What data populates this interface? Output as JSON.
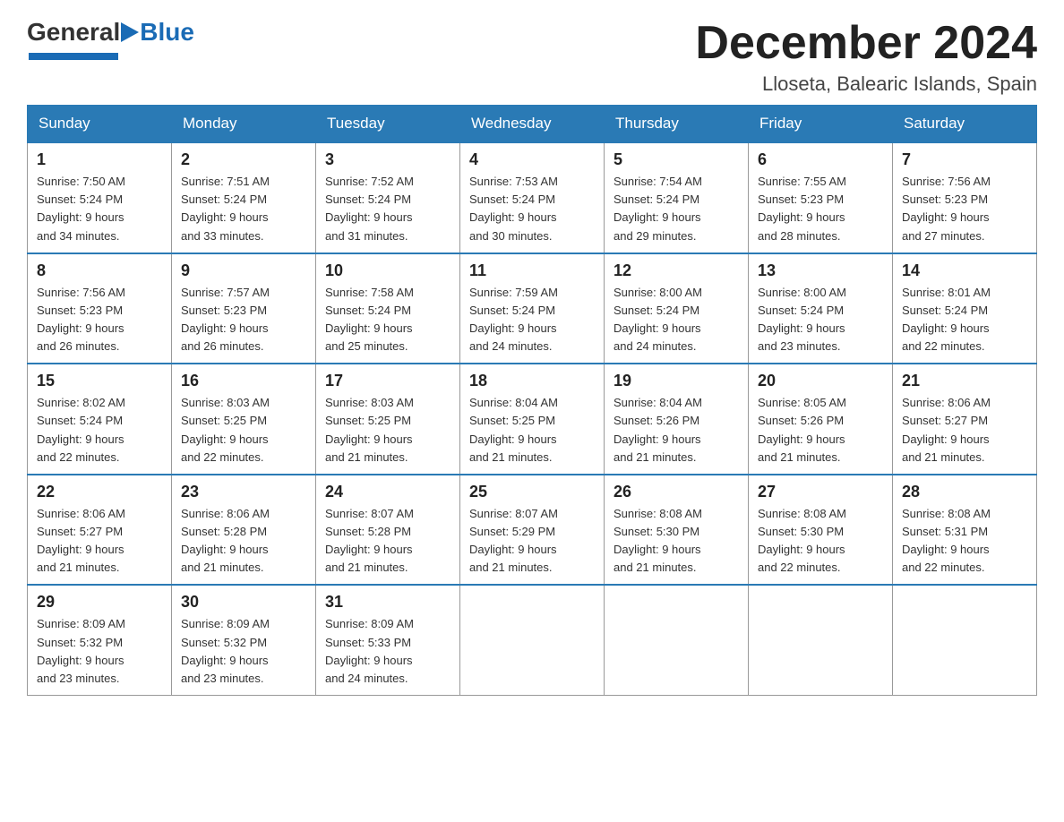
{
  "header": {
    "month_year": "December 2024",
    "location": "Lloseta, Balearic Islands, Spain",
    "logo_general": "General",
    "logo_blue": "Blue"
  },
  "weekdays": [
    "Sunday",
    "Monday",
    "Tuesday",
    "Wednesday",
    "Thursday",
    "Friday",
    "Saturday"
  ],
  "weeks": [
    [
      {
        "day": "1",
        "sunrise": "7:50 AM",
        "sunset": "5:24 PM",
        "daylight": "9 hours and 34 minutes."
      },
      {
        "day": "2",
        "sunrise": "7:51 AM",
        "sunset": "5:24 PM",
        "daylight": "9 hours and 33 minutes."
      },
      {
        "day": "3",
        "sunrise": "7:52 AM",
        "sunset": "5:24 PM",
        "daylight": "9 hours and 31 minutes."
      },
      {
        "day": "4",
        "sunrise": "7:53 AM",
        "sunset": "5:24 PM",
        "daylight": "9 hours and 30 minutes."
      },
      {
        "day": "5",
        "sunrise": "7:54 AM",
        "sunset": "5:24 PM",
        "daylight": "9 hours and 29 minutes."
      },
      {
        "day": "6",
        "sunrise": "7:55 AM",
        "sunset": "5:23 PM",
        "daylight": "9 hours and 28 minutes."
      },
      {
        "day": "7",
        "sunrise": "7:56 AM",
        "sunset": "5:23 PM",
        "daylight": "9 hours and 27 minutes."
      }
    ],
    [
      {
        "day": "8",
        "sunrise": "7:56 AM",
        "sunset": "5:23 PM",
        "daylight": "9 hours and 26 minutes."
      },
      {
        "day": "9",
        "sunrise": "7:57 AM",
        "sunset": "5:23 PM",
        "daylight": "9 hours and 26 minutes."
      },
      {
        "day": "10",
        "sunrise": "7:58 AM",
        "sunset": "5:24 PM",
        "daylight": "9 hours and 25 minutes."
      },
      {
        "day": "11",
        "sunrise": "7:59 AM",
        "sunset": "5:24 PM",
        "daylight": "9 hours and 24 minutes."
      },
      {
        "day": "12",
        "sunrise": "8:00 AM",
        "sunset": "5:24 PM",
        "daylight": "9 hours and 24 minutes."
      },
      {
        "day": "13",
        "sunrise": "8:00 AM",
        "sunset": "5:24 PM",
        "daylight": "9 hours and 23 minutes."
      },
      {
        "day": "14",
        "sunrise": "8:01 AM",
        "sunset": "5:24 PM",
        "daylight": "9 hours and 22 minutes."
      }
    ],
    [
      {
        "day": "15",
        "sunrise": "8:02 AM",
        "sunset": "5:24 PM",
        "daylight": "9 hours and 22 minutes."
      },
      {
        "day": "16",
        "sunrise": "8:03 AM",
        "sunset": "5:25 PM",
        "daylight": "9 hours and 22 minutes."
      },
      {
        "day": "17",
        "sunrise": "8:03 AM",
        "sunset": "5:25 PM",
        "daylight": "9 hours and 21 minutes."
      },
      {
        "day": "18",
        "sunrise": "8:04 AM",
        "sunset": "5:25 PM",
        "daylight": "9 hours and 21 minutes."
      },
      {
        "day": "19",
        "sunrise": "8:04 AM",
        "sunset": "5:26 PM",
        "daylight": "9 hours and 21 minutes."
      },
      {
        "day": "20",
        "sunrise": "8:05 AM",
        "sunset": "5:26 PM",
        "daylight": "9 hours and 21 minutes."
      },
      {
        "day": "21",
        "sunrise": "8:06 AM",
        "sunset": "5:27 PM",
        "daylight": "9 hours and 21 minutes."
      }
    ],
    [
      {
        "day": "22",
        "sunrise": "8:06 AM",
        "sunset": "5:27 PM",
        "daylight": "9 hours and 21 minutes."
      },
      {
        "day": "23",
        "sunrise": "8:06 AM",
        "sunset": "5:28 PM",
        "daylight": "9 hours and 21 minutes."
      },
      {
        "day": "24",
        "sunrise": "8:07 AM",
        "sunset": "5:28 PM",
        "daylight": "9 hours and 21 minutes."
      },
      {
        "day": "25",
        "sunrise": "8:07 AM",
        "sunset": "5:29 PM",
        "daylight": "9 hours and 21 minutes."
      },
      {
        "day": "26",
        "sunrise": "8:08 AM",
        "sunset": "5:30 PM",
        "daylight": "9 hours and 21 minutes."
      },
      {
        "day": "27",
        "sunrise": "8:08 AM",
        "sunset": "5:30 PM",
        "daylight": "9 hours and 22 minutes."
      },
      {
        "day": "28",
        "sunrise": "8:08 AM",
        "sunset": "5:31 PM",
        "daylight": "9 hours and 22 minutes."
      }
    ],
    [
      {
        "day": "29",
        "sunrise": "8:09 AM",
        "sunset": "5:32 PM",
        "daylight": "9 hours and 23 minutes."
      },
      {
        "day": "30",
        "sunrise": "8:09 AM",
        "sunset": "5:32 PM",
        "daylight": "9 hours and 23 minutes."
      },
      {
        "day": "31",
        "sunrise": "8:09 AM",
        "sunset": "5:33 PM",
        "daylight": "9 hours and 24 minutes."
      },
      null,
      null,
      null,
      null
    ]
  ],
  "labels": {
    "sunrise": "Sunrise:",
    "sunset": "Sunset:",
    "daylight": "Daylight:"
  }
}
